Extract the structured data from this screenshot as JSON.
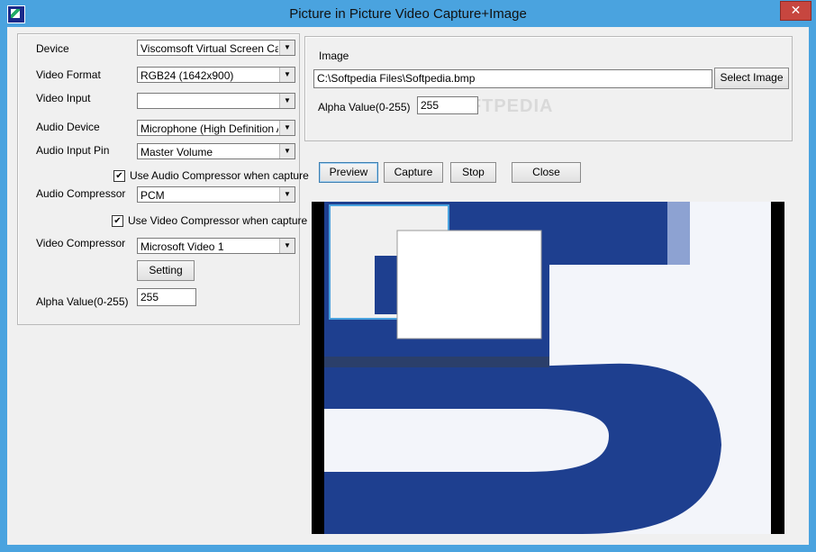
{
  "window": {
    "title": "Picture in Picture Video Capture+Image",
    "close_glyph": "✕"
  },
  "left": {
    "device_label": "Device",
    "device_value": "Viscomsoft Virtual Screen Captur",
    "video_format_label": "Video Format",
    "video_format_value": "RGB24 (1642x900)",
    "video_input_label": "Video Input",
    "video_input_value": "",
    "audio_device_label": "Audio Device",
    "audio_device_value": "Microphone (High Definition Audi",
    "audio_input_pin_label": "Audio Input Pin",
    "audio_input_pin_value": "Master Volume",
    "use_audio_compressor_label": "Use Audio Compressor when capture",
    "audio_compressor_label": "Audio Compressor",
    "audio_compressor_value": "PCM",
    "use_video_compressor_label": "Use Video Compressor when capture",
    "video_compressor_label": "Video Compressor",
    "video_compressor_value": "Microsoft Video 1",
    "setting_button": "Setting",
    "alpha_label": "Alpha Value(0-255)",
    "alpha_value": "255"
  },
  "image_group": {
    "title": "Image",
    "path_value": "C:\\Softpedia Files\\Softpedia.bmp",
    "select_button": "Select Image",
    "alpha_label": "Alpha Value(0-255)",
    "alpha_value": "255",
    "watermark": "SOFTPEDIA"
  },
  "actions": {
    "preview": "Preview",
    "capture": "Capture",
    "stop": "Stop",
    "close": "Close"
  },
  "glyphs": {
    "check": "✔",
    "arrow": "▼"
  },
  "colors": {
    "titlebar": "#4aa3df",
    "close": "#c7463f",
    "preview_blue": "#1e3f8f"
  }
}
